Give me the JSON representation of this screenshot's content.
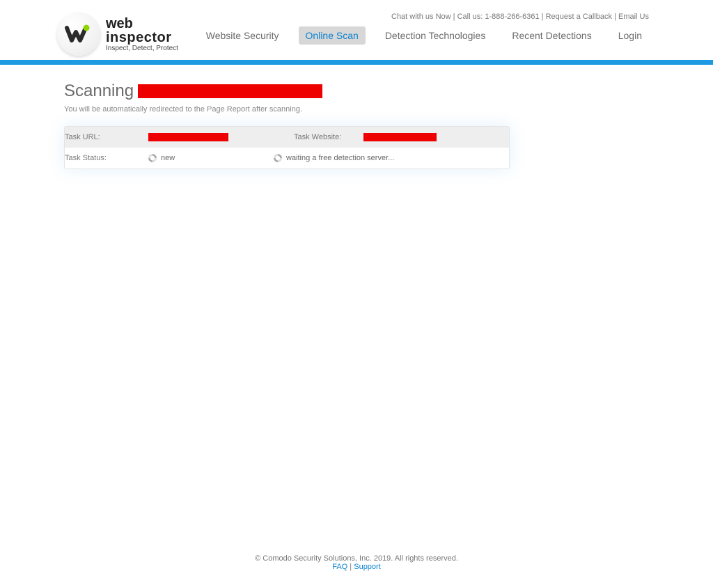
{
  "header": {
    "toplinks": {
      "chat": "Chat with us Now",
      "sep": " | ",
      "call_prefix": "Call us: ",
      "phone": "1-888-266-6361",
      "callback": "Request a Callback",
      "email": "Email Us"
    },
    "brand": {
      "line1": "web",
      "line2": "inspector",
      "line3": "Inspect, Detect, Protect"
    },
    "nav": [
      {
        "key": "website_security",
        "label": "Website Security"
      },
      {
        "key": "online_scan",
        "label": "Online Scan",
        "active": true
      },
      {
        "key": "detection_tech",
        "label": "Detection Technologies"
      },
      {
        "key": "recent_detections",
        "label": "Recent Detections"
      },
      {
        "key": "login",
        "label": "Login"
      }
    ]
  },
  "main": {
    "heading_prefix": "Scanning ",
    "subtitle": "You will be automatically redirected to the Page Report after scanning.",
    "row1": {
      "label_url": "Task URL:",
      "label_site": "Task Website:"
    },
    "row2": {
      "label_status": "Task Status:",
      "status_value": "new",
      "wait_msg": "waiting a free detection server..."
    }
  },
  "footer": {
    "copyright": "© Comodo Security Solutions, Inc. 2019. All rights reserved.",
    "faq": "FAQ",
    "sep": " | ",
    "support": "Support"
  }
}
